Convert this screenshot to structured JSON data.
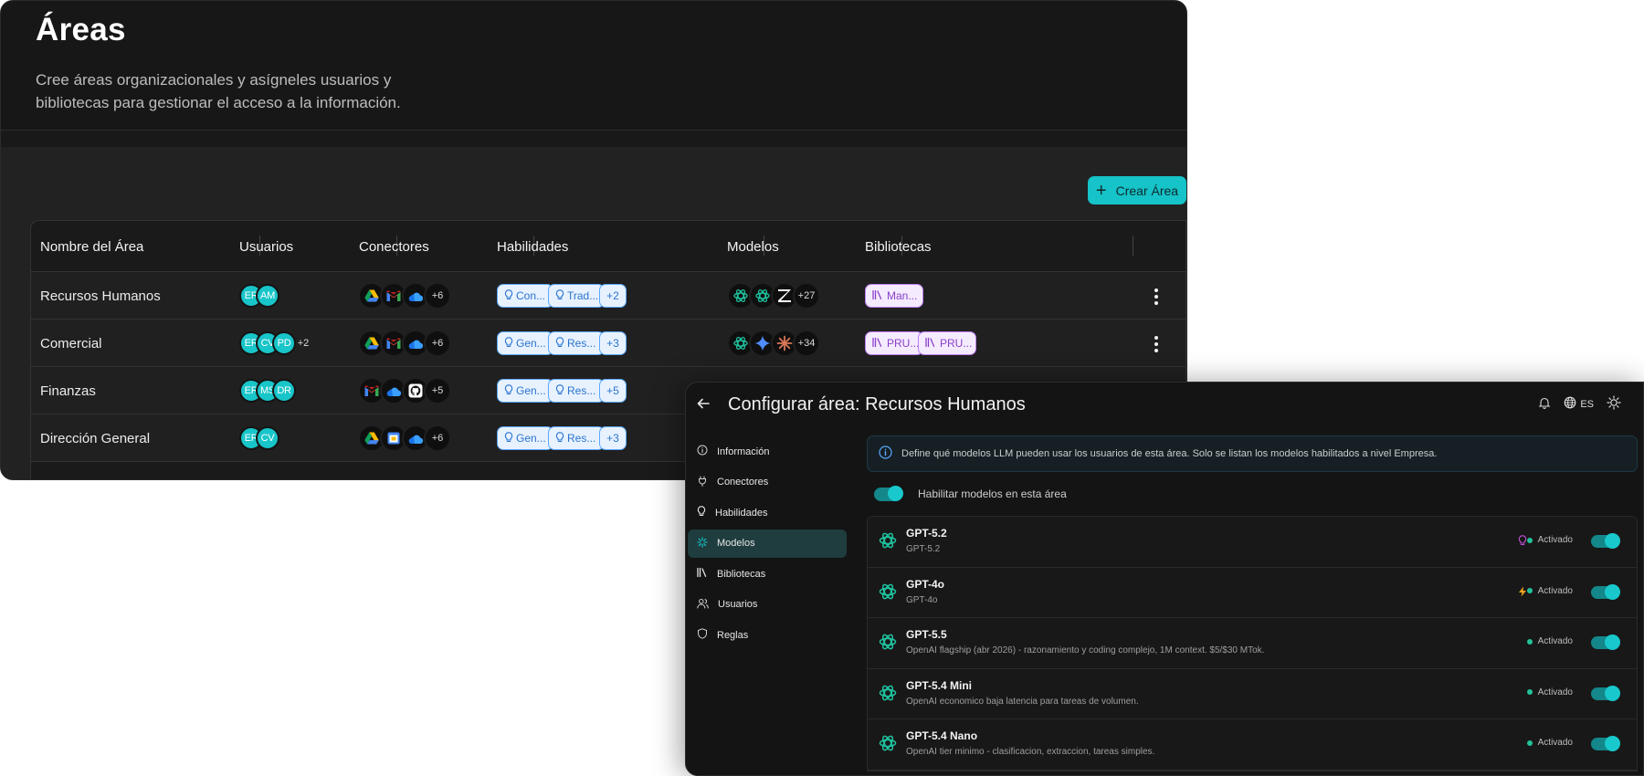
{
  "areas_page": {
    "title": "Áreas",
    "description": "Cree áreas organizacionales y asígneles usuarios y bibliotecas para gestionar el acceso a la información.",
    "create_button": "Crear Área",
    "columns": [
      "Nombre del Área",
      "Usuarios",
      "Conectores",
      "Habilidades",
      "Modelos",
      "Bibliotecas"
    ],
    "rows": [
      {
        "name": "Recursos Humanos",
        "users": [
          "ER",
          "AM"
        ],
        "users_more": "",
        "connectors": [
          "drive-icon",
          "gmail-icon",
          "onedrive-icon"
        ],
        "connectors_more": "+6",
        "skills": [
          "Con...",
          "Trad..."
        ],
        "skills_more": "+2",
        "models": [
          "openai-icon",
          "openai-icon",
          "zeta-icon"
        ],
        "models_more": "+27",
        "libraries": [
          "Man..."
        ]
      },
      {
        "name": "Comercial",
        "users": [
          "ER",
          "CV",
          "PD"
        ],
        "users_more": "+2",
        "connectors": [
          "drive-icon",
          "gmail-icon",
          "onedrive-icon"
        ],
        "connectors_more": "+6",
        "skills": [
          "Gen...",
          "Res..."
        ],
        "skills_more": "+3",
        "models": [
          "openai-icon",
          "gemini-icon",
          "claude-icon"
        ],
        "models_more": "+34",
        "libraries": [
          "PRU...",
          "PRU..."
        ]
      },
      {
        "name": "Finanzas",
        "users": [
          "ER",
          "MS",
          "DR"
        ],
        "users_more": "",
        "connectors": [
          "gmail-icon",
          "onedrive-icon",
          "github-icon"
        ],
        "connectors_more": "+5",
        "skills": [
          "Gen...",
          "Res..."
        ],
        "skills_more": "+5",
        "models": [],
        "models_more": "",
        "libraries": []
      },
      {
        "name": "Dirección General",
        "users": [
          "ER",
          "CV"
        ],
        "users_more": "",
        "connectors": [
          "drive-icon",
          "calendar-icon",
          "onedrive-icon"
        ],
        "connectors_more": "+6",
        "skills": [
          "Gen...",
          "Res..."
        ],
        "skills_more": "+3",
        "models": [],
        "models_more": "",
        "libraries": []
      }
    ]
  },
  "config_page": {
    "title": "Configurar área: Recursos Humanos",
    "language": "ES",
    "nav": [
      {
        "label": "Información",
        "icon": "info-icon"
      },
      {
        "label": "Conectores",
        "icon": "plug-icon"
      },
      {
        "label": "Habilidades",
        "icon": "lightbulb-icon"
      },
      {
        "label": "Modelos",
        "icon": "sparkle-icon"
      },
      {
        "label": "Bibliotecas",
        "icon": "books-icon"
      },
      {
        "label": "Usuarios",
        "icon": "users-icon"
      },
      {
        "label": "Reglas",
        "icon": "shield-icon"
      }
    ],
    "active_nav": "Modelos",
    "info_text": "Define qué modelos LLM pueden usar los usuarios de esta área. Solo se listan los modelos habilitados a nivel Empresa.",
    "toggle_label": "Habilitar modelos en esta área",
    "toggle_on": true,
    "models": [
      {
        "name": "GPT-5.2",
        "desc": "GPT-5.2",
        "badge": "lightbulb-icon",
        "badge_color": "#c24fd6",
        "status": "Activado",
        "enabled": true
      },
      {
        "name": "GPT-4o",
        "desc": "GPT-4o",
        "badge": "bolt-icon",
        "badge_color": "#f0a21b",
        "status": "Activado",
        "enabled": true
      },
      {
        "name": "GPT-5.5",
        "desc": "OpenAI flagship (abr 2026) - razonamiento y coding complejo, 1M context. $5/$30 MTok.",
        "badge": "",
        "status": "Activado",
        "enabled": true
      },
      {
        "name": "GPT-5.4 Mini",
        "desc": "OpenAI economico baja latencia para tareas de volumen.",
        "badge": "",
        "status": "Activado",
        "enabled": true
      },
      {
        "name": "GPT-5.4 Nano",
        "desc": "OpenAI tier minimo - clasificacion, extraccion, tareas simples.",
        "badge": "",
        "status": "Activado",
        "enabled": true
      }
    ]
  },
  "colors": {
    "accent": "#15c3c8",
    "skill_chip": "#5aa8ff",
    "library_chip": "#c07ef7",
    "status_green": "#23c29a"
  }
}
